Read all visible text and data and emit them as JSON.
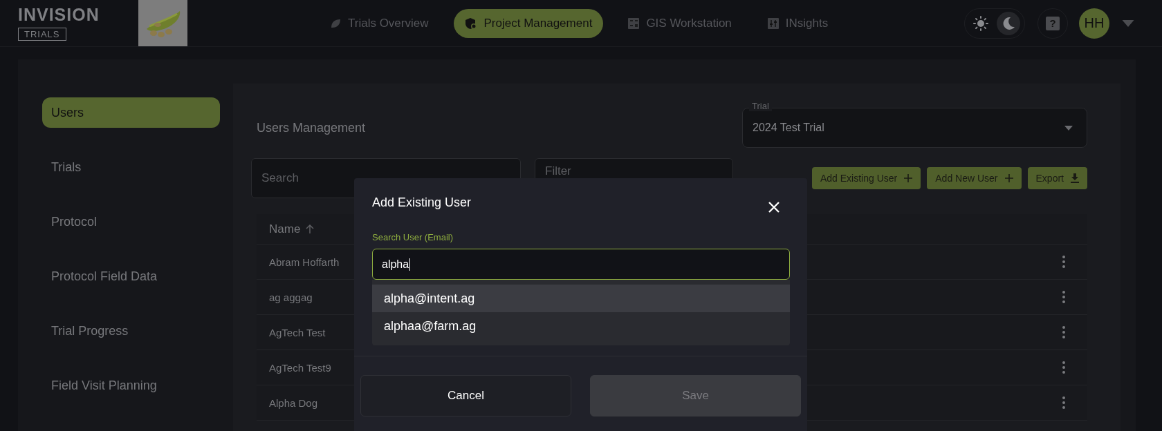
{
  "header": {
    "logo": {
      "title": "INVISION",
      "subtitle": "TRIALS"
    },
    "nav": [
      {
        "label": "Trials Overview",
        "kind": "leaf",
        "selected": false
      },
      {
        "label": "Project Management",
        "kind": "shield",
        "selected": true
      },
      {
        "label": "GIS Workstation",
        "kind": "calculator",
        "selected": false
      },
      {
        "label": "INsights",
        "kind": "sliders",
        "selected": false
      }
    ],
    "theme_toggle": [
      {
        "kind": "light",
        "selected": false
      },
      {
        "kind": "dark",
        "selected": true
      }
    ],
    "help": "?",
    "avatar": "HH"
  },
  "sidebar": {
    "items": [
      {
        "label": "Users",
        "selected": true
      },
      {
        "label": "Trials",
        "selected": false
      },
      {
        "label": "Protocol",
        "selected": false
      },
      {
        "label": "Protocol Field Data",
        "selected": false
      },
      {
        "label": "Trial Progress",
        "selected": false
      },
      {
        "label": "Field Visit Planning",
        "selected": false
      }
    ]
  },
  "main": {
    "title": "Users Management",
    "trial_select": {
      "label": "Trial",
      "value": "2024 Test Trial"
    },
    "search": {
      "placeholder": "Search"
    },
    "filter": {
      "placeholder": "Filter"
    },
    "buttons": [
      {
        "label": "Add Existing User",
        "kind": "plus"
      },
      {
        "label": "Add New User",
        "kind": "plus"
      },
      {
        "label": "Export",
        "kind": "download"
      }
    ],
    "table": {
      "columns": [
        {
          "label": "Name"
        }
      ],
      "rows": [
        {
          "name": "Abram Hoffarth"
        },
        {
          "name": "ag aggag"
        },
        {
          "name": "AgTech Test"
        },
        {
          "name": "AgTech Test9"
        },
        {
          "name": "Alpha Dog"
        }
      ]
    }
  },
  "dialog": {
    "title": "Add Existing User",
    "field": {
      "label": "Search User (Email)",
      "value": "alpha"
    },
    "options": [
      {
        "label": "alpha@intent.ag",
        "selected": true
      },
      {
        "label": "alphaa@farm.ag",
        "selected": false
      }
    ],
    "buttons": [
      {
        "label": "Cancel",
        "disabled": false
      },
      {
        "label": "Save",
        "disabled": true
      }
    ]
  }
}
